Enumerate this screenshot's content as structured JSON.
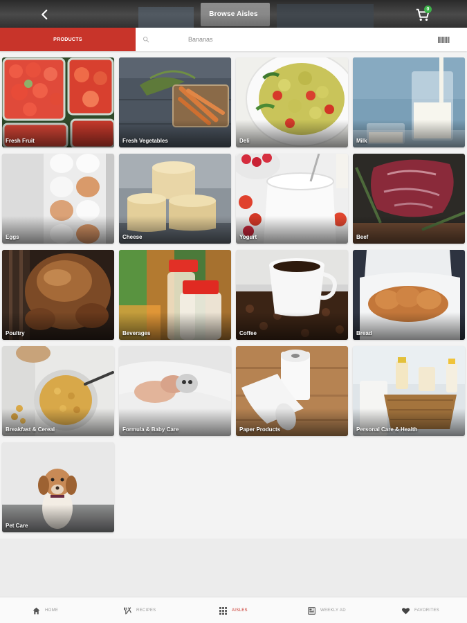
{
  "header": {
    "title": "Browse Aisles",
    "cart_count": "0",
    "back_icon": "chevron-left-icon",
    "cart_icon": "shopping-cart-icon"
  },
  "search": {
    "tab_label": "PRODUCTS",
    "placeholder": "Bananas",
    "search_icon": "search-icon",
    "barcode_icon": "barcode-icon"
  },
  "aisles": [
    {
      "label": "Fresh Fruit"
    },
    {
      "label": "Fresh Vegetables"
    },
    {
      "label": "Deli"
    },
    {
      "label": "Milk"
    },
    {
      "label": "Eggs"
    },
    {
      "label": "Cheese"
    },
    {
      "label": "Yogurt"
    },
    {
      "label": "Beef"
    },
    {
      "label": "Poultry"
    },
    {
      "label": "Beverages"
    },
    {
      "label": "Coffee"
    },
    {
      "label": "Bread"
    },
    {
      "label": "Breakfast & Cereal"
    },
    {
      "label": "Formula & Baby Care"
    },
    {
      "label": "Paper Products"
    },
    {
      "label": "Personal Care & Health"
    },
    {
      "label": "Pet Care"
    }
  ],
  "nav": {
    "home": "HOME",
    "recipes": "RECIPES",
    "aisles": "AISLES",
    "weekly_ad": "WEEKLY AD",
    "favorites": "FAVORITES"
  },
  "colors": {
    "accent": "#c8342a",
    "badge": "#3db34a"
  }
}
